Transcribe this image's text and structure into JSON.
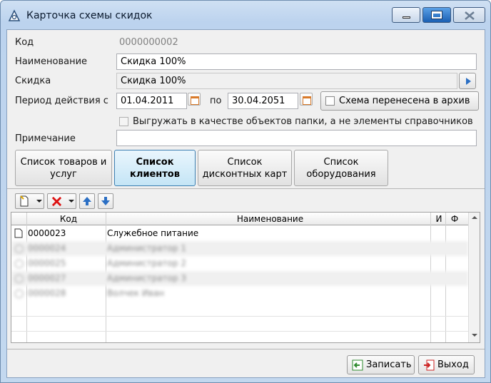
{
  "window": {
    "title": "Карточка схемы скидок"
  },
  "form": {
    "code_label": "Код",
    "code_value": "0000000002",
    "name_label": "Наименование",
    "name_value": "Скидка 100%",
    "discount_label": "Скидка",
    "discount_value": "Скидка 100%",
    "period_label": "Период действия с",
    "date_from": "01.04.2011",
    "to_label": "по",
    "date_to": "30.04.2051",
    "archive_label": "Схема перенесена в архив",
    "export_label": "Выгружать в качестве объектов папки, а не элементы справочников",
    "note_label": "Примечание",
    "note_value": ""
  },
  "tabs": [
    {
      "line1": "Список товаров и",
      "line2": "услуг"
    },
    {
      "line1": "Список",
      "line2": "клиентов"
    },
    {
      "line1": "Список",
      "line2": "дисконтных карт"
    },
    {
      "line1": "Список",
      "line2": "оборудования"
    }
  ],
  "grid": {
    "headers": {
      "code": "Код",
      "name": "Наименование",
      "i": "И",
      "f": "Ф"
    },
    "rows": [
      {
        "code": "0000023",
        "name": "Служебное питание"
      },
      {
        "code": "0000024",
        "name": "Администратор 1"
      },
      {
        "code": "0000025",
        "name": "Администратор 2"
      },
      {
        "code": "0000027",
        "name": "Администратор 3"
      },
      {
        "code": "0000028",
        "name": "Волчек Иван"
      }
    ]
  },
  "footer": {
    "save_label": "Записать",
    "exit_label": "Выход"
  }
}
